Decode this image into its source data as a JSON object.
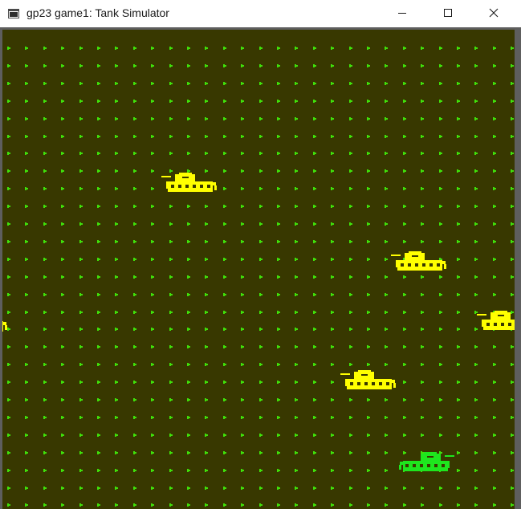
{
  "window": {
    "title": "gp23 game1: Tank Simulator"
  },
  "colors": {
    "background": "#383800",
    "grass": "#3fe00a",
    "enemy_tank": "#ffff00",
    "player_tank": "#1ee61e",
    "frame": "#5e5e5e"
  },
  "icons": {
    "app": "app-window-icon",
    "minimize": "minimize-icon",
    "maximize": "maximize-icon",
    "close": "close-icon"
  },
  "game": {
    "units": [
      {
        "type": "enemy-tank",
        "facing": "left"
      },
      {
        "type": "enemy-tank",
        "facing": "left"
      },
      {
        "type": "enemy-tank",
        "facing": "left"
      },
      {
        "type": "enemy-tank",
        "facing": "left"
      },
      {
        "type": "enemy-tank",
        "facing": "left"
      },
      {
        "type": "player-tank",
        "facing": "right"
      }
    ]
  }
}
